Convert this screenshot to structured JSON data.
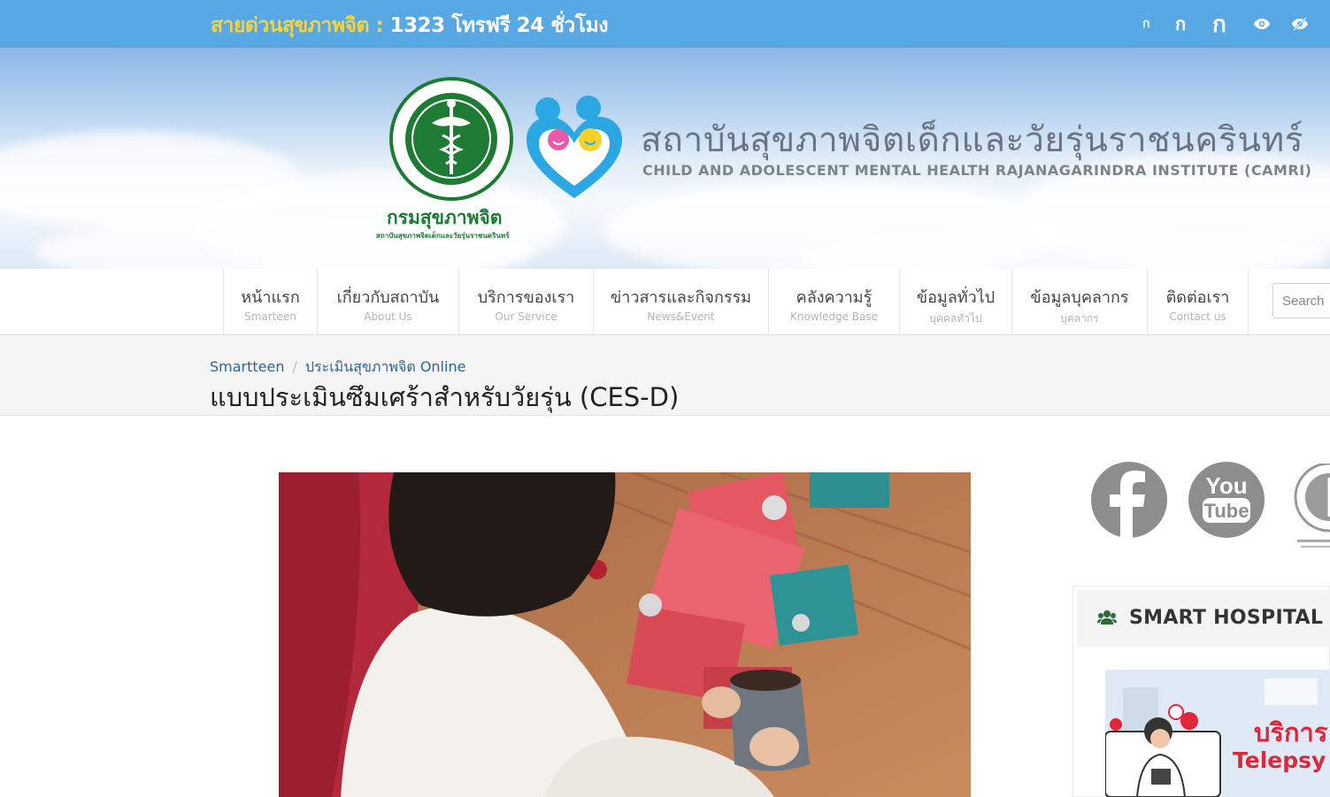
{
  "topbar": {
    "hotline_label": "สายด่วนสุขภาพจิต : ",
    "hotline_number": "1323 โทรฟรี 24 ชั่วโมง",
    "font_small": "ก",
    "font_medium": "ก",
    "font_large": "ก",
    "contrast_icon": "eye-icon",
    "hide_icon": "eye-slash-icon"
  },
  "banner": {
    "ministry_label": "กรมสุขภาพจิต",
    "ministry_sub": "สถาบันสุขภาพจิตเด็กและวัยรุ่นราชนครินทร์",
    "institute_th": "สถาบันสุขภาพจิตเด็กและวัยรุ่นราชนครินทร์",
    "institute_en": "CHILD AND ADOLESCENT MENTAL HEALTH RAJANAGARINDRA INSTITUTE (CAMRI)"
  },
  "nav": {
    "items": [
      {
        "th": "หน้าแรก",
        "en": "Smarteen"
      },
      {
        "th": "เกี่ยวกับสถาบัน",
        "en": "About Us"
      },
      {
        "th": "บริการของเรา",
        "en": "Our Service"
      },
      {
        "th": "ข่าวสารและกิจกรรม",
        "en": "News&Event"
      },
      {
        "th": "คลังความรู้",
        "en": "Knowledge Base"
      },
      {
        "th": "ข้อมูลทั่วไป",
        "en": "บุคคลทั่วไป"
      },
      {
        "th": "ข้อมูลบุคลากร",
        "en": "บุคลากร"
      },
      {
        "th": "ติดต่อเรา",
        "en": "Contact us"
      }
    ],
    "search_placeholder": "Search"
  },
  "breadcrumb": {
    "items": [
      "Smartteen",
      "ประเมินสุขภาพจิต Online"
    ],
    "separator": "/"
  },
  "page": {
    "title": "แบบประเมินซึมเศร้าสำหรับวัยรุ่น (CES-D)"
  },
  "sidebar": {
    "social_icons": [
      "facebook-icon",
      "youtube-icon",
      "dmh-logo-icon"
    ],
    "smart_hospital_title": "SMART HOSPITAL",
    "smart_hospital_icon": "users-icon",
    "telepsy_th": "บริการ",
    "telepsy_en": "Telepsy"
  },
  "colors": {
    "topbar_bg": "#57a8e3",
    "hotline_label": "#f6d23b",
    "link": "#2a6496",
    "ministry_green": "#1e7b34",
    "telepsy_red": "#e2263a"
  }
}
